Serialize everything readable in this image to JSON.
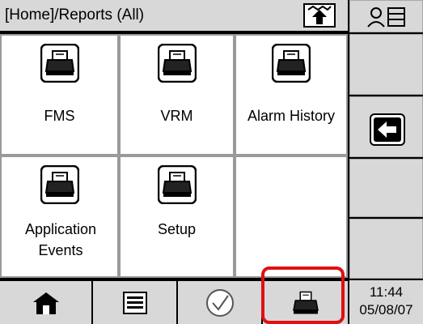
{
  "header": {
    "breadcrumb": "[Home]/Reports (All)"
  },
  "tiles": [
    {
      "label": "FMS",
      "icon": "printer-icon"
    },
    {
      "label": "VRM",
      "icon": "printer-icon"
    },
    {
      "label": "Alarm History",
      "icon": "printer-icon"
    },
    {
      "label": "Application Events",
      "icon": "printer-icon"
    },
    {
      "label": "Setup",
      "icon": "printer-icon"
    },
    {
      "label": "",
      "icon": ""
    }
  ],
  "status": {
    "time": "11:44",
    "date": "05/08/07"
  },
  "toolbar": {
    "items": [
      "home-icon",
      "list-icon",
      "checkmark-icon",
      "printer-icon"
    ],
    "selected": "printer-icon"
  },
  "colors": {
    "highlight": "#e01010",
    "panel": "#d8d8d8"
  }
}
